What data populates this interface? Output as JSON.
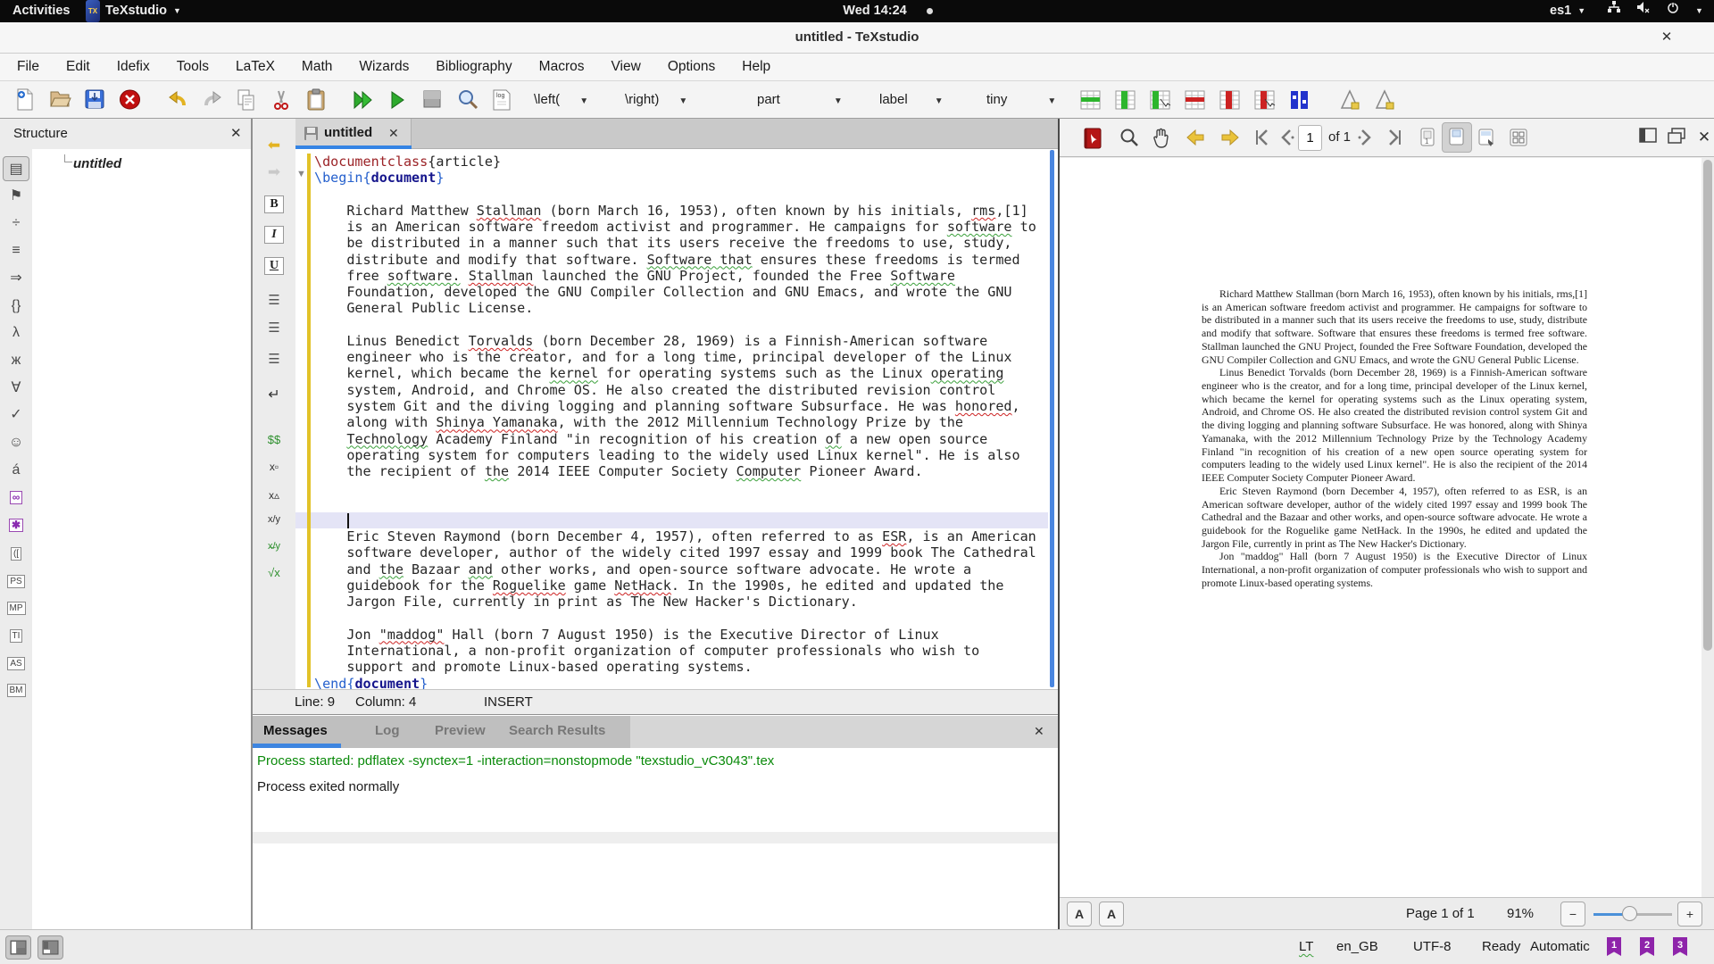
{
  "topbar": {
    "activities": "Activities",
    "app_name": "TeXstudio",
    "clock": "Wed 14:24",
    "keyboard_layout": "es1"
  },
  "titlebar": {
    "title": "untitled - TeXstudio"
  },
  "menubar": [
    "File",
    "Edit",
    "Idefix",
    "Tools",
    "LaTeX",
    "Math",
    "Wizards",
    "Bibliography",
    "Macros",
    "View",
    "Options",
    "Help"
  ],
  "toolbar": {
    "dropdowns": [
      "\\left(",
      "\\right)",
      "part",
      "label",
      "tiny"
    ]
  },
  "structure": {
    "title": "Structure",
    "root_item": "untitled"
  },
  "left_strip": [
    {
      "name": "structure-view",
      "glyph": "▤",
      "kind": "active"
    },
    {
      "name": "bookmarks",
      "glyph": "⚑",
      "kind": ""
    },
    {
      "name": "symbols-operators",
      "glyph": "÷",
      "kind": ""
    },
    {
      "name": "symbols-relations",
      "glyph": "≡",
      "kind": ""
    },
    {
      "name": "symbols-arrows",
      "glyph": "⇒",
      "kind": ""
    },
    {
      "name": "symbols-delimiters",
      "glyph": "{}",
      "kind": ""
    },
    {
      "name": "symbols-greek",
      "glyph": "λ",
      "kind": ""
    },
    {
      "name": "symbols-cyrillic",
      "glyph": "ж",
      "kind": ""
    },
    {
      "name": "symbols-misc-math",
      "glyph": "∀",
      "kind": ""
    },
    {
      "name": "symbols-misc-text",
      "glyph": "✓",
      "kind": ""
    },
    {
      "name": "symbols-smileys",
      "glyph": "☺",
      "kind": ""
    },
    {
      "name": "symbols-accents",
      "glyph": "á",
      "kind": ""
    },
    {
      "name": "symbols-ams",
      "glyph": "∞",
      "kind": "purple"
    },
    {
      "name": "symbols-special",
      "glyph": "✱",
      "kind": "purple"
    },
    {
      "name": "symbols-brackets",
      "glyph": "([",
      "kind": "boxed"
    },
    {
      "name": "pstricks",
      "glyph": "PS",
      "kind": "boxed"
    },
    {
      "name": "metapost",
      "glyph": "MP",
      "kind": "boxed"
    },
    {
      "name": "tikz",
      "glyph": "TI",
      "kind": "boxed"
    },
    {
      "name": "asymptote",
      "glyph": "AS",
      "kind": "boxed"
    },
    {
      "name": "beamer",
      "glyph": "BM",
      "kind": "boxed"
    }
  ],
  "vtbar": [
    {
      "name": "jump-back",
      "glyph": "⬅",
      "color": "#e3b322",
      "size": 17
    },
    {
      "name": "jump-forward",
      "glyph": "➡",
      "color": "#c9c9c9",
      "size": 17
    },
    {
      "name": "bold",
      "glyph": "B",
      "kind": "boxed",
      "color": "#222",
      "size": 14
    },
    {
      "name": "italic",
      "glyph": "I",
      "kind": "boxed-italic",
      "color": "#222",
      "size": 14
    },
    {
      "name": "underline",
      "glyph": "U",
      "kind": "boxed-under",
      "color": "#222",
      "size": 14
    },
    {
      "name": "align-left",
      "glyph": "☰",
      "color": "#555",
      "size": 15
    },
    {
      "name": "align-center",
      "glyph": "☰",
      "color": "#555",
      "size": 15
    },
    {
      "name": "align-right",
      "glyph": "☰",
      "color": "#555",
      "size": 15
    },
    {
      "name": "newline",
      "glyph": "↵",
      "color": "#333",
      "size": 16
    },
    {
      "name": "math-mode",
      "glyph": "$$",
      "color": "#2d8f2d",
      "size": 13
    },
    {
      "name": "subscript",
      "glyph": "x▫",
      "color": "#333",
      "size": 12
    },
    {
      "name": "superscript",
      "glyph": "x▵",
      "color": "#333",
      "size": 12
    },
    {
      "name": "fraction",
      "glyph": "x/y",
      "color": "#333",
      "size": 11
    },
    {
      "name": "dfrac",
      "glyph": "x̶/y",
      "color": "#2d8f2d",
      "size": 11
    },
    {
      "name": "sqrt",
      "glyph": "√x",
      "color": "#2d8f2d",
      "size": 13
    }
  ],
  "editor": {
    "tab": "untitled",
    "status": {
      "line": "Line: 9",
      "column": "Column: 4",
      "mode": "INSERT"
    },
    "lines": [
      [
        [
          "\\documentclass",
          "c1"
        ],
        [
          "{",
          "br"
        ],
        [
          "article",
          "grn"
        ],
        [
          "}",
          "br"
        ]
      ],
      [
        [
          "\\begin{",
          "bl"
        ],
        [
          "document",
          "env"
        ],
        [
          "}",
          "bl"
        ]
      ],
      [],
      [
        [
          "    Richard Matthew ",
          ""
        ],
        [
          "Stallman",
          "spr"
        ],
        [
          " (born March 16, 1953), often known by his initials, ",
          ""
        ],
        [
          "rms",
          "spr"
        ],
        [
          ",[1]",
          ""
        ]
      ],
      [
        [
          "    is an American software freedom activist and programmer. He campaigns for ",
          ""
        ],
        [
          "software",
          "spg"
        ],
        [
          " to",
          ""
        ]
      ],
      [
        [
          "    be distributed in a manner such that its users receive the freedoms to use, study,",
          ""
        ]
      ],
      [
        [
          "    distribute and modify that software. ",
          ""
        ],
        [
          "Software that",
          "spg"
        ],
        [
          " ensures these freedoms is termed",
          ""
        ]
      ],
      [
        [
          "    free ",
          ""
        ],
        [
          "software.",
          "spg"
        ],
        [
          " ",
          ""
        ],
        [
          "Stallman",
          "spr"
        ],
        [
          " launched the GNU Project, founded the Free ",
          ""
        ],
        [
          "Software",
          "spg"
        ]
      ],
      [
        [
          "    Foundation, developed the GNU Compiler Collection and GNU Emacs, and wrote the GNU",
          ""
        ]
      ],
      [
        [
          "    General Public License.",
          ""
        ]
      ],
      [],
      [
        [
          "    Linus Benedict ",
          ""
        ],
        [
          "Torvalds",
          "spr"
        ],
        [
          " (born December 28, 1969) is a Finnish-American software",
          ""
        ]
      ],
      [
        [
          "    engineer who is the creator, and for a long time, principal developer of the Linux",
          ""
        ]
      ],
      [
        [
          "    kernel, which became the ",
          ""
        ],
        [
          "kernel",
          "spg"
        ],
        [
          " for operating systems such as the Linux ",
          ""
        ],
        [
          "operating",
          "spg"
        ]
      ],
      [
        [
          "    system, Android, and Chrome OS. He also created the distributed revision control",
          ""
        ]
      ],
      [
        [
          "    system Git and the diving logging and planning software Subsurface. He was ",
          ""
        ],
        [
          "honored",
          "spr"
        ],
        [
          ",",
          ""
        ]
      ],
      [
        [
          "    along with ",
          ""
        ],
        [
          "Shinya Yamanaka",
          "spr"
        ],
        [
          ", with the 2012 Millennium Technology Prize by the",
          ""
        ]
      ],
      [
        [
          "    ",
          ""
        ],
        [
          "Technology",
          "spg"
        ],
        [
          " Academy Finland \"in recognition of his creation ",
          ""
        ],
        [
          "of",
          "spg"
        ],
        [
          " a new open source",
          ""
        ]
      ],
      [
        [
          "    operating system for computers leading to the widely used Linux kernel\". He is also",
          ""
        ]
      ],
      [
        [
          "    the recipient of ",
          ""
        ],
        [
          "the",
          "spg"
        ],
        [
          " 2014 IEEE Computer Society ",
          ""
        ],
        [
          "Computer",
          "spg"
        ],
        [
          " Pioneer Award.",
          ""
        ]
      ],
      [],
      [],
      [],
      [
        [
          "    Eric Steven Raymond (born December 4, 1957), often referred to as ",
          ""
        ],
        [
          "ESR",
          "spr"
        ],
        [
          ", is an American",
          ""
        ]
      ],
      [
        [
          "    software developer, author of the widely cited 1997 essay and 1999 book The Cathedral",
          ""
        ]
      ],
      [
        [
          "    and ",
          ""
        ],
        [
          "the",
          "spg"
        ],
        [
          " Bazaar ",
          ""
        ],
        [
          "and",
          "spg"
        ],
        [
          " other works, and open-source software advocate. He wrote a",
          ""
        ]
      ],
      [
        [
          "    guidebook for the ",
          ""
        ],
        [
          "Roguelike",
          "spr"
        ],
        [
          " game ",
          ""
        ],
        [
          "NetHack",
          "spr"
        ],
        [
          ". In the 1990s, he edited and updated the",
          ""
        ]
      ],
      [
        [
          "    Jargon File, currently in print as The New Hacker's Dictionary.",
          ""
        ]
      ],
      [],
      [
        [
          "    Jon ",
          ""
        ],
        [
          "\"maddog\"",
          "spr"
        ],
        [
          " Hall (born 7 August 1950) is the Executive Director of Linux",
          ""
        ]
      ],
      [
        [
          "    International, a non-profit organization of computer professionals who wish to",
          ""
        ]
      ],
      [
        [
          "    support and promote Linux-based operating systems.",
          ""
        ]
      ],
      [
        [
          "\\end{",
          "bl"
        ],
        [
          "document",
          "env"
        ],
        [
          "}",
          "bl"
        ]
      ]
    ],
    "cursor_line_index": 22
  },
  "messages": {
    "tabs": [
      "Messages",
      "Log",
      "Preview",
      "Search Results"
    ],
    "active_tab": "Messages",
    "lines": [
      {
        "text": "Process started: pdflatex -synctex=1 -interaction=nonstopmode \"texstudio_vC3043\".tex",
        "color": "#0a8a0a"
      },
      {
        "text": "Process exited normally",
        "color": "#1a1a1a"
      }
    ]
  },
  "pdf": {
    "page_spin": "1",
    "of_label": "of 1",
    "page_label": "Page 1 of 1",
    "zoom_label": "91%",
    "paragraphs": [
      "Richard Matthew Stallman (born March 16, 1953), often known by his initials, rms,[1] is an American software freedom activist and programmer.  He campaigns for software to be distributed in a manner such that its users receive the freedoms to use, study, distribute and modify that software. Software that ensures these freedoms is termed free software.  Stallman launched the GNU Project, founded the Free Software Foundation, developed the GNU Compiler Collection and GNU Emacs, and wrote the GNU General Public License.",
      "Linus Benedict Torvalds (born December 28, 1969) is a Finnish-American software engineer who is the creator, and for a long time, principal developer of the Linux kernel, which became the kernel for operating systems such as the Linux operating system, Android, and Chrome OS. He also created the distributed revision control system Git and the diving logging and planning software Subsurface.  He was honored, along with Shinya Yamanaka, with the 2012 Millennium Technology Prize by the Technology Academy Finland \"in recognition of his creation of a new open source operating system for computers leading to the widely used Linux kernel\".  He is also the recipient of the 2014 IEEE Computer Society Computer Pioneer Award.",
      "Eric Steven Raymond (born December 4, 1957), often referred to as ESR, is an American software developer, author of the widely cited 1997 essay and 1999 book The Cathedral and the Bazaar and other works, and open-source software advocate.  He wrote a guidebook for the Roguelike game NetHack.  In the 1990s, he edited and updated the Jargon File, currently in print as The New Hacker's Dictionary.",
      "Jon \"maddog\" Hall (born 7 August 1950) is the Executive Director of Linux International, a non-profit organization of computer professionals who wish to support and promote Linux-based operating systems."
    ]
  },
  "statusbar": {
    "items": [
      "LT",
      "en_GB",
      "UTF-8",
      "Ready",
      "Automatic"
    ],
    "tags": [
      "1",
      "2",
      "3"
    ]
  }
}
